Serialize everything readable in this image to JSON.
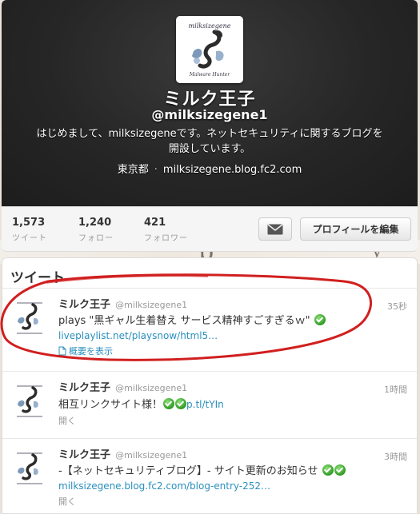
{
  "profile": {
    "display_name": "ミルク王子",
    "screen_name": "@milksizegene1",
    "bio": "はじめまして、milksizegeneです。ネットセキュリティに関するブログを開設しています。",
    "location": "東京都",
    "separator": "·",
    "website": "milksizegene.blog.fc2.com",
    "avatar_caption": "milksizegene",
    "avatar_sub_caption": "Malware Hunter"
  },
  "stats": [
    {
      "value": "1,573",
      "label": "ツイート"
    },
    {
      "value": "1,240",
      "label": "フォロー"
    },
    {
      "value": "421",
      "label": "フォロワー"
    }
  ],
  "actions": {
    "message_icon": "envelope-icon",
    "edit_profile_label": "プロフィールを編集"
  },
  "tweets_heading": "ツイート",
  "tweets": [
    {
      "name": "ミルク王子",
      "handle": "@milksizegene1",
      "time": "35秒",
      "text": "plays \"黒ギャル生着替え サービス精神すごすぎるｗ\"",
      "link": "liveplaylist.net/playsnow/html5…",
      "action": "概要を表示"
    },
    {
      "name": "ミルク王子",
      "handle": "@milksizegene1",
      "time": "1時間",
      "text": "相互リンクサイト様！",
      "link": "p.tl/tYIn",
      "action": "開く"
    },
    {
      "name": "ミルク王子",
      "handle": "@milksizegene1",
      "time": "3時間",
      "text": "-【ネットセキュリティブログ】- サイト更新のお知らせ",
      "link": "milksizegene.blog.fc2.com/blog-entry-252…",
      "action": "開く"
    }
  ],
  "colors": {
    "link": "#2a8fbd",
    "header_bg": "#262626",
    "annotation_red": "#d11f1f",
    "check_green": "#2e9a23"
  }
}
